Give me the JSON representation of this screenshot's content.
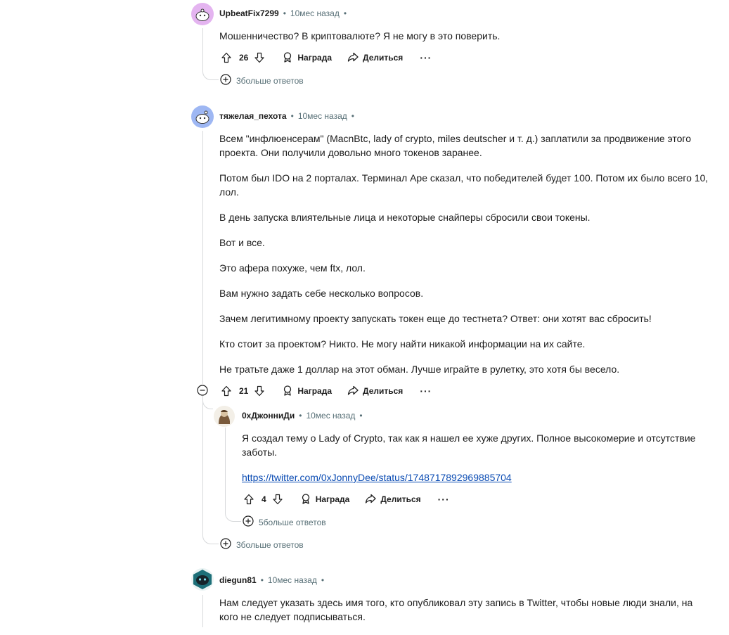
{
  "comments": [
    {
      "author": "UpbeatFix7299",
      "time": "10мес назад",
      "avatar_color": "#e4b4f0",
      "body": [
        "Мошенничество? В криптовалюте? Я не могу в это поверить."
      ],
      "score": "26",
      "award_label": "Награда",
      "share_label": "Делиться",
      "more_label": "···",
      "more_replies": "3больше ответов"
    },
    {
      "author": "тяжелая_пехота",
      "time": "10мес назад",
      "avatar_color": "#9eb7f3",
      "body": [
        "Всем \"инфлюенсерам\" (MacnBtc, lady of crypto, miles deutscher и т. д.) заплатили за продвижение этого проекта. Они получили довольно много токенов заранее.",
        "Потом был IDO на 2 порталах. Терминал Ape сказал, что победителей будет 100. Потом их было всего 10, лол.",
        "В день запуска влиятельные лица и некоторые снайперы сбросили свои токены.",
        "Вот и все.",
        "Это афера похуже, чем ftx, лол.",
        "Вам нужно задать себе несколько вопросов.",
        "Зачем легитимному проекту запускать токен еще до тестнета? Ответ: они хотят вас сбросить!",
        "Кто стоит за проектом? Никто. Не могу найти никакой информации на их сайте.",
        "Не тратьте даже 1 доллар на этот обман. Лучше играйте в рулетку, это хотя бы весело."
      ],
      "score": "21",
      "award_label": "Награда",
      "share_label": "Делиться",
      "more_label": "···",
      "more_replies": "3больше ответов",
      "reply": {
        "author": "0хДжонниДи",
        "time": "10мес назад",
        "body": "Я создал тему о Lady of Crypto, так как я нашел ее хуже других. Полное высокомерие и отсутствие заботы.",
        "link": "https://twitter.com/0xJonnyDee/status/1748717892969885704",
        "score": "4",
        "award_label": "Награда",
        "share_label": "Делиться",
        "more_label": "···",
        "more_replies": "5больше ответов"
      }
    },
    {
      "author": "diegun81",
      "time": "10мес назад",
      "avatar_color": "#1d6f78",
      "body": [
        "Нам следует указать здесь имя того, кто опубликовал эту запись в Twitter, чтобы новые люди знали, на кого не следует подписываться."
      ]
    }
  ]
}
